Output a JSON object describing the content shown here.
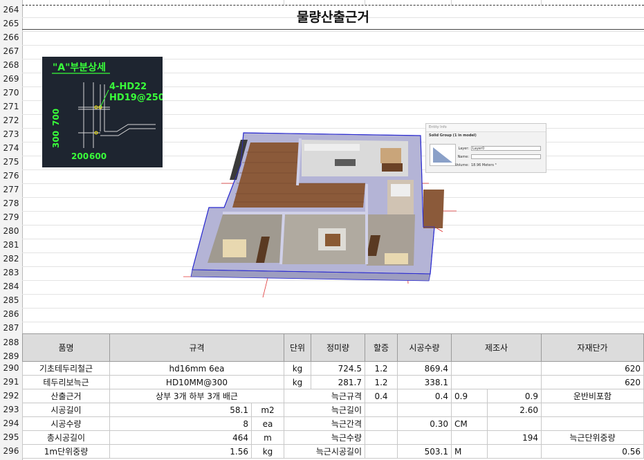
{
  "sheet": {
    "row_numbers": [
      "264",
      "265",
      "266",
      "267",
      "268",
      "269",
      "270",
      "271",
      "272",
      "273",
      "274",
      "275",
      "276",
      "277",
      "278",
      "279",
      "280",
      "281",
      "282",
      "283",
      "284",
      "285",
      "286",
      "287",
      "288",
      "289",
      "290",
      "291",
      "292",
      "293",
      "294",
      "295",
      "296"
    ],
    "title": "물량산출근거"
  },
  "detail": {
    "heading": "\"A\"부분상세",
    "bar1": "4-HD22",
    "bar2": "HD19@250",
    "dim_700": "700",
    "dim_300": "300",
    "dim_200": "200",
    "dim_600": "600"
  },
  "entity_info": {
    "title": "Entity Info",
    "subtitle": "Solid Group (1 in model)",
    "layer_label": "Layer:",
    "layer_value": "Layer0",
    "name_label": "Name:",
    "volume_label": "Volume:",
    "volume_value": "18.96 Meters ³"
  },
  "table": {
    "headers": {
      "name": "품명",
      "spec": "규격",
      "unit": "단위",
      "net": "정미량",
      "extra": "할증",
      "qty": "시공수량",
      "maker": "제조사",
      "price": "자재단가"
    },
    "rows": [
      {
        "name": "기초테두리철근",
        "spec": "hd16mm 6ea",
        "unit": "kg",
        "net": "724.5",
        "extra": "1.2",
        "qty": "869.4",
        "price": "620"
      },
      {
        "name": "테두리보늑근",
        "spec": "HD10MM@300",
        "unit": "kg",
        "net": "281.7",
        "extra": "1.2",
        "qty": "338.1",
        "price": "620"
      },
      {
        "name": "산출근거",
        "spec": "상부 3개  하부 3개 배근",
        "k1": "늑근규격",
        "v1": "0.4",
        "v2": "0.4",
        "v3": "0.9",
        "v4": "0.9",
        "note": "운반비포함"
      },
      {
        "name": "시공길이",
        "val": "58.1",
        "unit2": "m2",
        "k1": "늑근길이",
        "v4": "2.60"
      },
      {
        "name": "시공수량",
        "val": "8",
        "unit2": "ea",
        "k1": "늑근간격",
        "v2": "0.30",
        "v3": "CM"
      },
      {
        "name": "총시공길이",
        "val": "464",
        "unit2": "m",
        "k1": "늑근수량",
        "v4": "194",
        "note": "늑근단위중량"
      },
      {
        "name": "1m단위중량",
        "val": "1.56",
        "unit2": "kg",
        "k1": "늑근시공길이",
        "v3": "503.1",
        "v3b": "M",
        "price": "0.56"
      }
    ]
  }
}
